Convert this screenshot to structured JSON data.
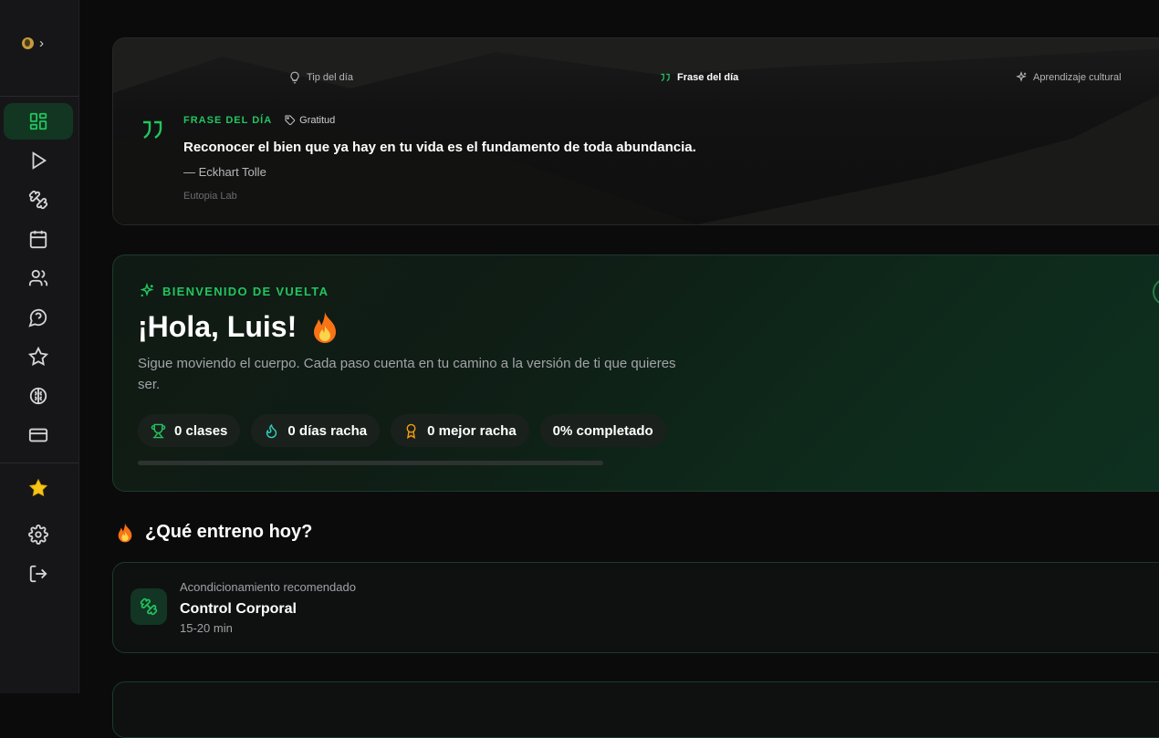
{
  "colors": {
    "accent": "#22c55e",
    "background": "#0b0b0c",
    "sidebar": "#161618"
  },
  "sidebar": {
    "top_icon": "globe-icon",
    "nav": [
      {
        "name": "dashboard",
        "icon": "dashboard-grid-icon",
        "active": true
      },
      {
        "name": "play",
        "icon": "play-icon"
      },
      {
        "name": "workout",
        "icon": "dumbbell-icon"
      },
      {
        "name": "calendar",
        "icon": "calendar-icon"
      },
      {
        "name": "community",
        "icon": "users-icon"
      },
      {
        "name": "help",
        "icon": "help-chat-icon"
      },
      {
        "name": "favorites",
        "icon": "star-icon"
      },
      {
        "name": "mind",
        "icon": "brain-icon"
      },
      {
        "name": "billing",
        "icon": "credit-card-icon"
      }
    ],
    "bottom": [
      "premium-star-icon",
      "settings-gear-icon",
      "logout-icon"
    ]
  },
  "daily": {
    "tabs": [
      {
        "label": "Tip del día",
        "icon": "lightbulb-icon"
      },
      {
        "label": "Frase del día",
        "icon": "quote-icon",
        "active": true
      },
      {
        "label": "Aprendizaje cultural",
        "icon": "sparkles-icon"
      }
    ],
    "kicker": "FRASE DEL DÍA",
    "tag": "Gratitud",
    "quote": "Reconocer el bien que ya hay en tu vida es el fundamento de toda abundancia.",
    "author": "— Eckhart Tolle",
    "brand": "Eutopia Lab"
  },
  "welcome": {
    "kicker": "BIENVENIDO DE VUELTA",
    "title": "¡Hola, Luis!",
    "subtitle": "Sigue moviendo el cuerpo. Cada paso cuenta en tu camino a la versión de ti que quieres ser.",
    "stats": [
      {
        "label": "0 clases",
        "icon": "trophy-icon"
      },
      {
        "label": "0 días racha",
        "icon": "flame-icon"
      },
      {
        "label": "0 mejor racha",
        "icon": "medal-icon"
      },
      {
        "label": "0% completado"
      }
    ],
    "progress_fraction": 0
  },
  "today": {
    "title": "¿Qué entreno hoy?",
    "recommended": {
      "kicker": "Acondicionamiento recomendado",
      "title": "Control Corporal",
      "duration": "15-20 min"
    }
  }
}
